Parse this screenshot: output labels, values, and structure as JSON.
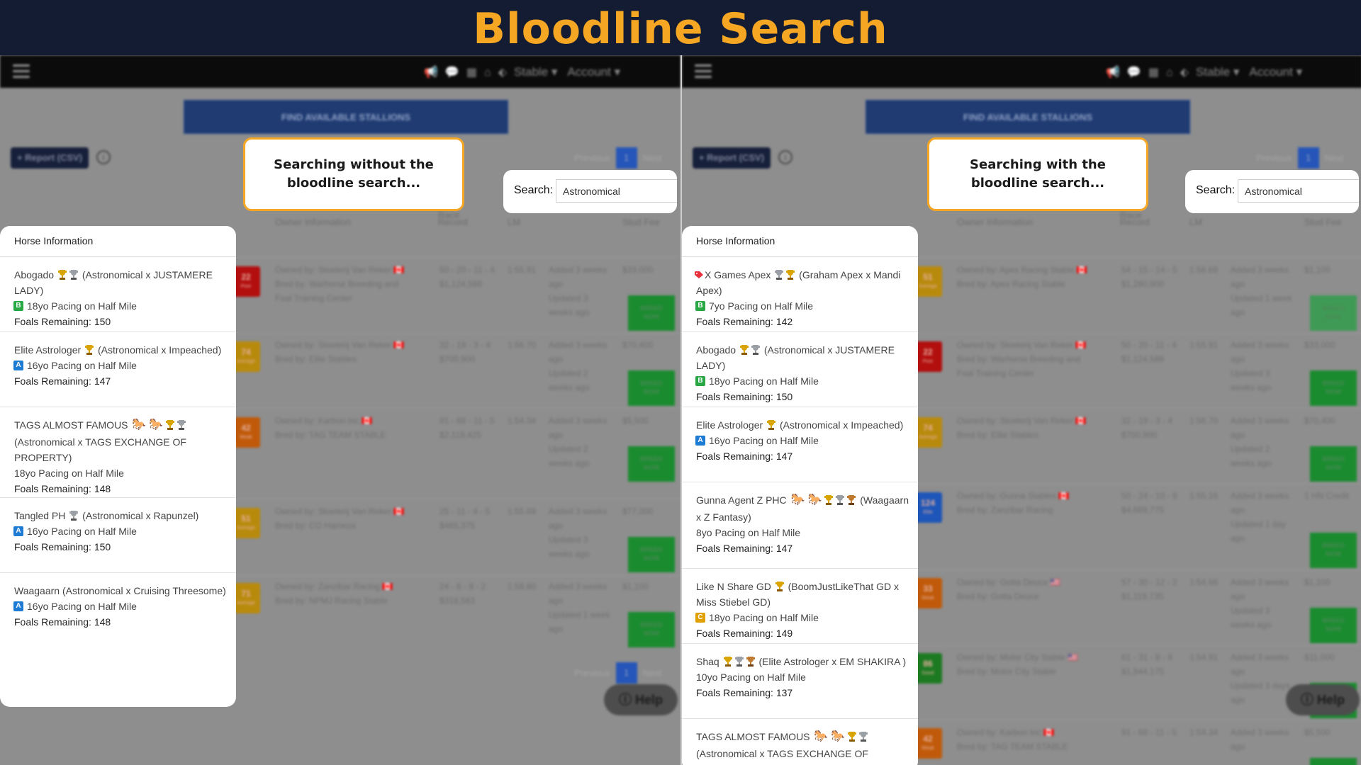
{
  "banner": {
    "title": "Bloodline Search"
  },
  "nav": {
    "stable_label": "Stable ▾",
    "account_label": "Account ▾"
  },
  "page": {
    "find_button": "FIND AVAILABLE STALLIONS",
    "report_button": "+ Report (CSV)",
    "pager": {
      "previous": "Previous",
      "page": "1",
      "next": "Next"
    },
    "help_button": "Help",
    "columns": {
      "horse": "Horse Information",
      "owner": "Owner Information",
      "race_record_1": "Race",
      "race_record_2": "Record",
      "lm": "LM",
      "stud_fee": "Stud Fee"
    }
  },
  "left": {
    "callout": "Searching without the bloodline search...",
    "search": {
      "label": "Search:",
      "value": "Astronomical"
    },
    "horses": [
      {
        "name": "Abogado",
        "parentage": "(Astronomical x JUSTAMERE LADY)",
        "grade": "B",
        "desc": "18yo Pacing on Half Mile",
        "foals_label": "Foals Remaining:",
        "foals": "150"
      },
      {
        "name": "Elite Astrologer",
        "parentage": "(Astronomical x Impeached)",
        "grade": "A",
        "desc": "16yo Pacing on Half Mile",
        "foals_label": "Foals Remaining:",
        "foals": "147"
      },
      {
        "name": "TAGS ALMOST FAMOUS",
        "parentage": "(Astronomical x TAGS EXCHANGE OF PROPERTY)",
        "grade": "",
        "desc": "18yo Pacing on Half Mile",
        "foals_label": "Foals Remaining:",
        "foals": "148"
      },
      {
        "name": "Tangled PH",
        "parentage": "(Astronomical x Rapunzel)",
        "grade": "A",
        "desc": "16yo Pacing on Half Mile",
        "foals_label": "Foals Remaining:",
        "foals": "150"
      },
      {
        "name": "Waagaarn",
        "parentage": "(Astronomical x Cruising Threesome)",
        "grade": "A",
        "desc": "16yo Pacing on Half Mile",
        "foals_label": "Foals Remaining:",
        "foals": "148"
      }
    ],
    "background_rows": [
      {
        "rating": "22",
        "rating_label": "Poor",
        "rating_color": "#b30f0f",
        "owner": "Owned by: Stoeterij Van Reker 🇨🇦",
        "bred": "Bred by: Warhorse Breeding and Foal Training Center",
        "record": "50 - 20 - 11 - 4",
        "earnings": "$1,124,588",
        "lm": "1:55.91",
        "added": "Added 3 weeks ago",
        "updated": "Updated 3 weeks ago",
        "fee": "$33,000"
      },
      {
        "rating": "74",
        "rating_label": "Average",
        "rating_color": "#b88a0c",
        "owner": "Owned by: Stoeterij Van Reker 🇨🇦",
        "bred": "Bred by: Elite Stables",
        "record": "32 - 19 - 3 - 4",
        "earnings": "$700,900",
        "lm": "1:56.70",
        "added": "Added 3 weeks ago",
        "updated": "Updated 2 weeks ago",
        "fee": "$70,400"
      },
      {
        "rating": "42",
        "rating_label": "Weak",
        "rating_color": "#c05a0a",
        "owner": "Owned by: Karbon Inc 🇨🇦",
        "bred": "Bred by: TAG TEAM STABLE",
        "record": "91 - 68 - 11 - 5",
        "earnings": "$2,119,425",
        "lm": "1:54.34",
        "added": "Added 3 weeks ago",
        "updated": "Updated 2 weeks ago",
        "fee": "$5,500"
      },
      {
        "rating": "51",
        "rating_label": "Average",
        "rating_color": "#b88a0c",
        "owner": "Owned by: Stoeterij Van Reker 🇨🇦",
        "bred": "Bred by: CO Harness",
        "record": "25 - 11 - 4 - 5",
        "earnings": "$465,375",
        "lm": "1:55.69",
        "added": "Added 3 weeks ago",
        "updated": "Updated 3 weeks ago",
        "fee": "$77,000"
      },
      {
        "rating": "71",
        "rating_label": "Average",
        "rating_color": "#b88a0c",
        "owner": "Owned by: Zanzibar Racing 🇨🇦",
        "bred": "Bred by: NPMJ Racing Stable",
        "record": "24 - 6 - 9 - 2",
        "earnings": "$318,563",
        "lm": "1:58.80",
        "added": "Added 3 weeks ago",
        "updated": "Updated 1 week ago",
        "fee": "$1,100"
      }
    ]
  },
  "right": {
    "callout": "Searching with the bloodline search...",
    "search": {
      "label": "Search:",
      "value": "Astronomical"
    },
    "horses": [
      {
        "name": "X Games Apex",
        "parentage": "(Graham Apex x Mandi Apex)",
        "grade": "B",
        "desc": "7yo Pacing on Half Mile",
        "foals_label": "Foals Remaining:",
        "foals": "142"
      },
      {
        "name": "Abogado",
        "parentage": "(Astronomical x JUSTAMERE LADY)",
        "grade": "B",
        "desc": "18yo Pacing on Half Mile",
        "foals_label": "Foals Remaining:",
        "foals": "150"
      },
      {
        "name": "Elite Astrologer",
        "parentage": "(Astronomical x Impeached)",
        "grade": "A",
        "desc": "16yo Pacing on Half Mile",
        "foals_label": "Foals Remaining:",
        "foals": "147"
      },
      {
        "name": "Gunna Agent Z PHC",
        "parentage": "(Waagaarn x Z Fantasy)",
        "grade": "",
        "desc": "8yo Pacing on Half Mile",
        "foals_label": "Foals Remaining:",
        "foals": "147"
      },
      {
        "name": "Like N Share GD",
        "parentage": "(BoomJustLikeThat GD x Miss Stiebel GD)",
        "grade": "C",
        "desc": "18yo Pacing on Half Mile",
        "foals_label": "Foals Remaining:",
        "foals": "149"
      },
      {
        "name": "Shaq",
        "parentage": "(Elite Astrologer x EM SHAKIRA )",
        "grade": "",
        "desc": "10yo Pacing on Half Mile",
        "foals_label": "Foals Remaining:",
        "foals": "137"
      },
      {
        "name": "TAGS ALMOST FAMOUS",
        "parentage": "(Astronomical x TAGS EXCHANGE OF PROPERTY)",
        "grade": "",
        "desc": "",
        "foals_label": "",
        "foals": ""
      }
    ],
    "background_rows": [
      {
        "rating": "51",
        "rating_label": "Average",
        "rating_color": "#b88a0c",
        "owner": "Owned by: Apex Racing Stable 🇨🇦",
        "bred": "Bred by: Apex Racing Stable",
        "record": "54 - 15 - 14 - 5",
        "earnings": "$1,280,900",
        "lm": "1:56.69",
        "added": "Added 3 weeks ago",
        "updated": "Updated 1 week ago",
        "fee": "$1,100"
      },
      {
        "rating": "22",
        "rating_label": "Poor",
        "rating_color": "#b30f0f",
        "owner": "Owned by: Stoeterij Van Reker 🇨🇦",
        "bred": "Bred by: Warhorse Breeding and Foal Training Center",
        "record": "50 - 20 - 11 - 4",
        "earnings": "$1,124,588",
        "lm": "1:55.91",
        "added": "Added 3 weeks ago",
        "updated": "Updated 3 weeks ago",
        "fee": "$33,000"
      },
      {
        "rating": "74",
        "rating_label": "Average",
        "rating_color": "#b88a0c",
        "owner": "Owned by: Stoeterij Van Reker 🇨🇦",
        "bred": "Bred by: Elite Stables",
        "record": "32 - 19 - 3 - 4",
        "earnings": "$700,900",
        "lm": "1:56.70",
        "added": "Added 3 weeks ago",
        "updated": "Updated 2 weeks ago",
        "fee": "$70,400"
      },
      {
        "rating": "124",
        "rating_label": "Elite",
        "rating_color": "#1d55b8",
        "owner": "Owned by: Gunna Stables 🇨🇦",
        "bred": "Bred by: Zanzibar Racing",
        "record": "50 - 24 - 10 - 8",
        "earnings": "$4,689,775",
        "lm": "1:55.16",
        "added": "Added 3 weeks ago",
        "updated": "Updated 1 day ago",
        "fee": "1 HN Credit"
      },
      {
        "rating": "33",
        "rating_label": "Weak",
        "rating_color": "#c05a0a",
        "owner": "Owned by: Gotta Deuce 🇺🇸",
        "bred": "Bred by: Gotta Deuce",
        "record": "57 - 30 - 12 - 2",
        "earnings": "$1,119,735",
        "lm": "1:54.66",
        "added": "Added 3 weeks ago",
        "updated": "Updated 3 weeks ago",
        "fee": "$1,100"
      },
      {
        "rating": "86",
        "rating_label": "Good",
        "rating_color": "#1d7a22",
        "owner": "Owned by: Motor City Stable 🇺🇸",
        "bred": "Bred by: Motor City Stable",
        "record": "61 - 31 - 8 - 6",
        "earnings": "$1,844,175",
        "lm": "1:54.91",
        "added": "Added 3 weeks ago",
        "updated": "Updated 3 days ago",
        "fee": "$11,000"
      },
      {
        "rating": "42",
        "rating_label": "Weak",
        "rating_color": "#c05a0a",
        "owner": "Owned by: Karbon Inc 🇨🇦",
        "bred": "Bred by: TAG TEAM STABLE",
        "record": "91 - 68 - 11 - 5",
        "earnings": "",
        "lm": "1:54.34",
        "added": "Added 3 weeks ago",
        "updated": "",
        "fee": "$5,500"
      }
    ]
  }
}
